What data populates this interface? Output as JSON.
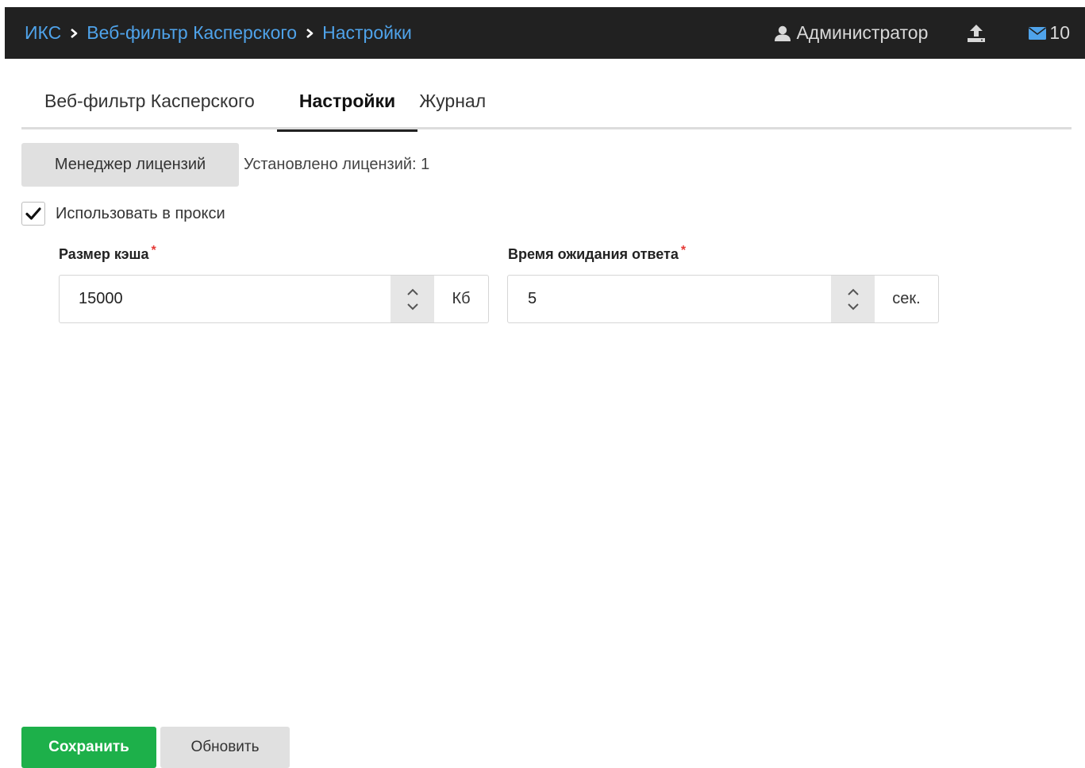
{
  "header": {
    "breadcrumbs": [
      {
        "label": "ИКС"
      },
      {
        "label": "Веб-фильтр Касперского"
      },
      {
        "label": "Настройки"
      }
    ],
    "user_label": "Администратор",
    "user_icon": "user-icon",
    "upload_icon": "upload-icon",
    "mail_icon": "envelope-icon",
    "mail_count": "10",
    "colors": {
      "bar_bg": "#212121",
      "link": "#4fa3ea"
    }
  },
  "tabs": [
    {
      "label": "Веб-фильтр Касперского",
      "active": false
    },
    {
      "label": "Настройки",
      "active": true
    },
    {
      "label": "Журнал",
      "active": false
    }
  ],
  "license": {
    "button_label": "Менеджер лицензий",
    "status_text": "Установлено лицензий: 1"
  },
  "proxy": {
    "checkbox_label": "Использовать в прокси",
    "checked": true
  },
  "fields": {
    "cache_size": {
      "label": "Размер кэша",
      "required_mark": "*",
      "value": "15000",
      "unit": "Кб"
    },
    "timeout": {
      "label": "Время ожидания ответа",
      "required_mark": "*",
      "value": "5",
      "unit": "сек."
    }
  },
  "actions": {
    "save_label": "Сохранить",
    "refresh_label": "Обновить",
    "save_color": "#1db04a"
  }
}
